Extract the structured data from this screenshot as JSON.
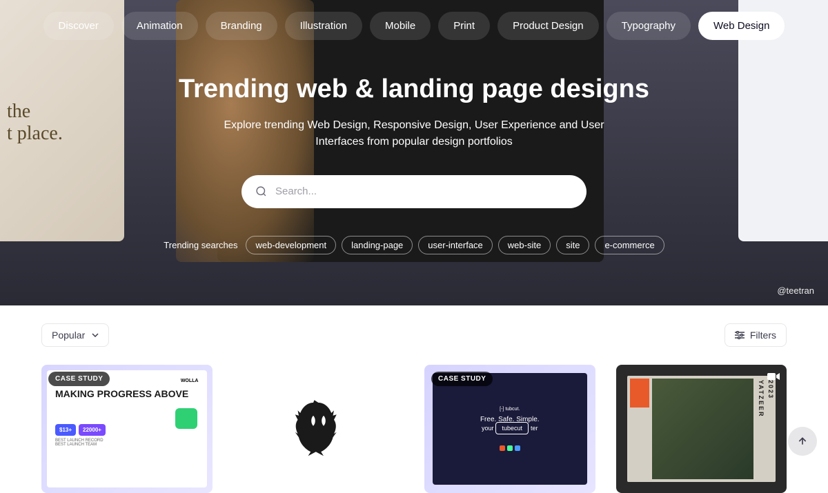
{
  "categories": [
    {
      "label": "Discover",
      "active": false
    },
    {
      "label": "Animation",
      "active": false
    },
    {
      "label": "Branding",
      "active": false
    },
    {
      "label": "Illustration",
      "active": false
    },
    {
      "label": "Mobile",
      "active": false
    },
    {
      "label": "Print",
      "active": false
    },
    {
      "label": "Product Design",
      "active": false
    },
    {
      "label": "Typography",
      "active": false
    },
    {
      "label": "Web Design",
      "active": true
    }
  ],
  "hero": {
    "title": "Trending web & landing page designs",
    "subtitle": "Explore trending Web Design, Responsive Design, User Experience and User Interfaces from popular design portfolios",
    "credit": "@teetran"
  },
  "search": {
    "placeholder": "Search..."
  },
  "trending": {
    "label": "Trending searches",
    "tags": [
      "web-development",
      "landing-page",
      "user-interface",
      "web-site",
      "site",
      "e-commerce"
    ]
  },
  "controls": {
    "sort": "Popular",
    "filters_label": "Filters"
  },
  "shots": [
    {
      "badge": "CASE STUDY",
      "kind": "wolla",
      "headline": "MAKING PROGRESS ABOVE",
      "stat1": "$13+",
      "stat2": "22000+",
      "tagline1": "BEST LAUNCH RECORD",
      "tagline2": "BEST LAUNCH TEAM",
      "brand": "WOLLA"
    },
    {
      "badge": null,
      "kind": "griffin"
    },
    {
      "badge": "CASE STUDY",
      "kind": "tubecut",
      "line1": "Free. Safe. Simple.",
      "chip": "tubecut"
    },
    {
      "badge": null,
      "kind": "yatzeer",
      "has_video": true,
      "side1": "YATZEER",
      "side2": "2023"
    }
  ]
}
